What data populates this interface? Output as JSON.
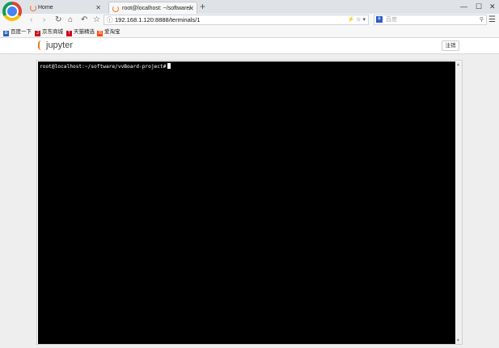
{
  "browser": {
    "tabs": [
      {
        "title": "Home",
        "active": false
      },
      {
        "title": "root@localhost: ~/software/v",
        "active": true
      }
    ],
    "address": "192.168.1.120:8888/terminals/1",
    "search_placeholder": "百度",
    "bookmarks": [
      {
        "label": "百度一下",
        "icon": "paw-icon",
        "color": "#2e5cc9"
      },
      {
        "label": "京东商城",
        "icon": "jd-icon",
        "color": "#c81623"
      },
      {
        "label": "天猫精选",
        "icon": "tmall-icon",
        "color": "#d4001b"
      },
      {
        "label": "爱淘宝",
        "icon": "taobao-icon",
        "color": "#ff4400"
      }
    ]
  },
  "jupyter": {
    "logo_text": "jupyter",
    "logout_label": "注销",
    "accent": "#f37626"
  },
  "terminal": {
    "prompt": "root@localhost:~/software/vvBoard-project#",
    "background": "#000000",
    "foreground": "#ffffff"
  }
}
